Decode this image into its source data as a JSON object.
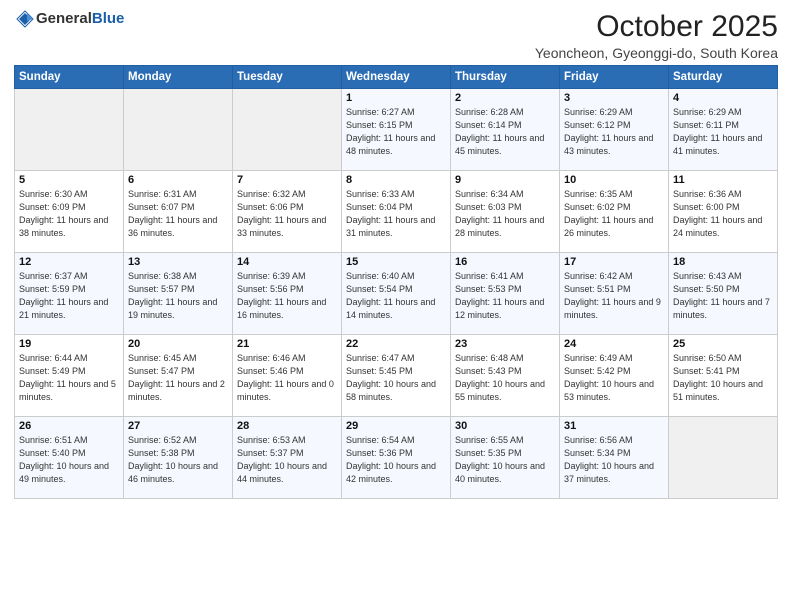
{
  "logo": {
    "general": "General",
    "blue": "Blue"
  },
  "header": {
    "month": "October 2025",
    "location": "Yeoncheon, Gyeonggi-do, South Korea"
  },
  "weekdays": [
    "Sunday",
    "Monday",
    "Tuesday",
    "Wednesday",
    "Thursday",
    "Friday",
    "Saturday"
  ],
  "weeks": [
    [
      {
        "num": "",
        "info": ""
      },
      {
        "num": "",
        "info": ""
      },
      {
        "num": "",
        "info": ""
      },
      {
        "num": "1",
        "info": "Sunrise: 6:27 AM\nSunset: 6:15 PM\nDaylight: 11 hours\nand 48 minutes."
      },
      {
        "num": "2",
        "info": "Sunrise: 6:28 AM\nSunset: 6:14 PM\nDaylight: 11 hours\nand 45 minutes."
      },
      {
        "num": "3",
        "info": "Sunrise: 6:29 AM\nSunset: 6:12 PM\nDaylight: 11 hours\nand 43 minutes."
      },
      {
        "num": "4",
        "info": "Sunrise: 6:29 AM\nSunset: 6:11 PM\nDaylight: 11 hours\nand 41 minutes."
      }
    ],
    [
      {
        "num": "5",
        "info": "Sunrise: 6:30 AM\nSunset: 6:09 PM\nDaylight: 11 hours\nand 38 minutes."
      },
      {
        "num": "6",
        "info": "Sunrise: 6:31 AM\nSunset: 6:07 PM\nDaylight: 11 hours\nand 36 minutes."
      },
      {
        "num": "7",
        "info": "Sunrise: 6:32 AM\nSunset: 6:06 PM\nDaylight: 11 hours\nand 33 minutes."
      },
      {
        "num": "8",
        "info": "Sunrise: 6:33 AM\nSunset: 6:04 PM\nDaylight: 11 hours\nand 31 minutes."
      },
      {
        "num": "9",
        "info": "Sunrise: 6:34 AM\nSunset: 6:03 PM\nDaylight: 11 hours\nand 28 minutes."
      },
      {
        "num": "10",
        "info": "Sunrise: 6:35 AM\nSunset: 6:02 PM\nDaylight: 11 hours\nand 26 minutes."
      },
      {
        "num": "11",
        "info": "Sunrise: 6:36 AM\nSunset: 6:00 PM\nDaylight: 11 hours\nand 24 minutes."
      }
    ],
    [
      {
        "num": "12",
        "info": "Sunrise: 6:37 AM\nSunset: 5:59 PM\nDaylight: 11 hours\nand 21 minutes."
      },
      {
        "num": "13",
        "info": "Sunrise: 6:38 AM\nSunset: 5:57 PM\nDaylight: 11 hours\nand 19 minutes."
      },
      {
        "num": "14",
        "info": "Sunrise: 6:39 AM\nSunset: 5:56 PM\nDaylight: 11 hours\nand 16 minutes."
      },
      {
        "num": "15",
        "info": "Sunrise: 6:40 AM\nSunset: 5:54 PM\nDaylight: 11 hours\nand 14 minutes."
      },
      {
        "num": "16",
        "info": "Sunrise: 6:41 AM\nSunset: 5:53 PM\nDaylight: 11 hours\nand 12 minutes."
      },
      {
        "num": "17",
        "info": "Sunrise: 6:42 AM\nSunset: 5:51 PM\nDaylight: 11 hours\nand 9 minutes."
      },
      {
        "num": "18",
        "info": "Sunrise: 6:43 AM\nSunset: 5:50 PM\nDaylight: 11 hours\nand 7 minutes."
      }
    ],
    [
      {
        "num": "19",
        "info": "Sunrise: 6:44 AM\nSunset: 5:49 PM\nDaylight: 11 hours\nand 5 minutes."
      },
      {
        "num": "20",
        "info": "Sunrise: 6:45 AM\nSunset: 5:47 PM\nDaylight: 11 hours\nand 2 minutes."
      },
      {
        "num": "21",
        "info": "Sunrise: 6:46 AM\nSunset: 5:46 PM\nDaylight: 11 hours\nand 0 minutes."
      },
      {
        "num": "22",
        "info": "Sunrise: 6:47 AM\nSunset: 5:45 PM\nDaylight: 10 hours\nand 58 minutes."
      },
      {
        "num": "23",
        "info": "Sunrise: 6:48 AM\nSunset: 5:43 PM\nDaylight: 10 hours\nand 55 minutes."
      },
      {
        "num": "24",
        "info": "Sunrise: 6:49 AM\nSunset: 5:42 PM\nDaylight: 10 hours\nand 53 minutes."
      },
      {
        "num": "25",
        "info": "Sunrise: 6:50 AM\nSunset: 5:41 PM\nDaylight: 10 hours\nand 51 minutes."
      }
    ],
    [
      {
        "num": "26",
        "info": "Sunrise: 6:51 AM\nSunset: 5:40 PM\nDaylight: 10 hours\nand 49 minutes."
      },
      {
        "num": "27",
        "info": "Sunrise: 6:52 AM\nSunset: 5:38 PM\nDaylight: 10 hours\nand 46 minutes."
      },
      {
        "num": "28",
        "info": "Sunrise: 6:53 AM\nSunset: 5:37 PM\nDaylight: 10 hours\nand 44 minutes."
      },
      {
        "num": "29",
        "info": "Sunrise: 6:54 AM\nSunset: 5:36 PM\nDaylight: 10 hours\nand 42 minutes."
      },
      {
        "num": "30",
        "info": "Sunrise: 6:55 AM\nSunset: 5:35 PM\nDaylight: 10 hours\nand 40 minutes."
      },
      {
        "num": "31",
        "info": "Sunrise: 6:56 AM\nSunset: 5:34 PM\nDaylight: 10 hours\nand 37 minutes."
      },
      {
        "num": "",
        "info": ""
      }
    ]
  ]
}
